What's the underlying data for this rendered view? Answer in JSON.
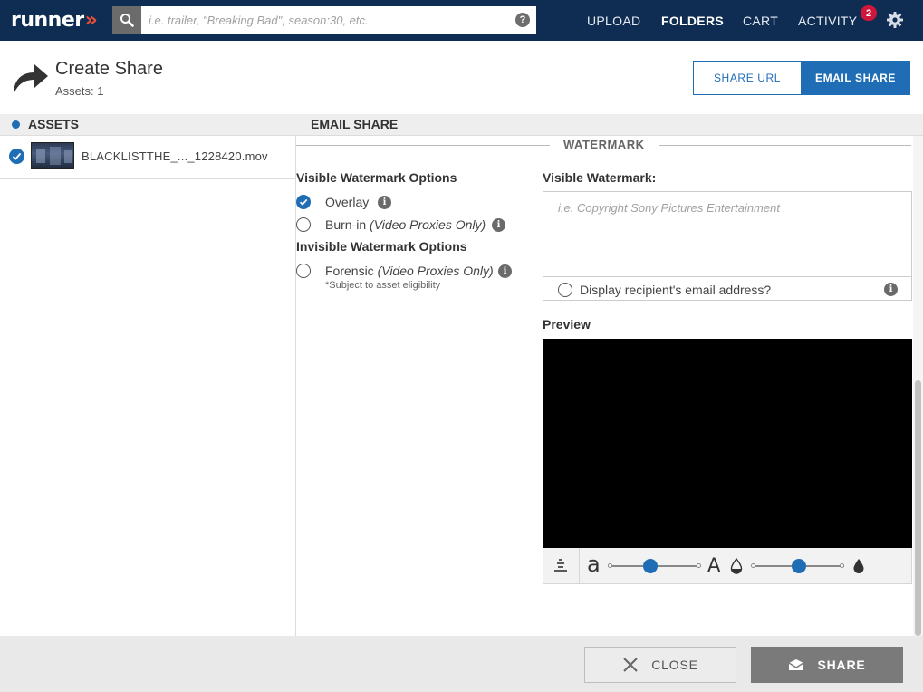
{
  "app": {
    "logo_text": "runner",
    "logo_chevrons": "»"
  },
  "search": {
    "placeholder": "i.e. trailer, \"Breaking Bad\", season:30, etc.",
    "value": ""
  },
  "nav": {
    "upload": "UPLOAD",
    "folders": "FOLDERS",
    "cart": "CART",
    "activity": "ACTIVITY",
    "activity_badge": "2",
    "active_item": "FOLDERS"
  },
  "header": {
    "title": "Create Share",
    "assets_count": "Assets: 1"
  },
  "share_mode": {
    "share_url_label": "SHARE URL",
    "email_share_label": "EMAIL SHARE",
    "selected": "EMAIL SHARE"
  },
  "sections": {
    "assets_heading": "ASSETS",
    "email_share_heading": "EMAIL SHARE"
  },
  "assets": [
    {
      "name": "BLACKLISTTHE_..._1228420.mov",
      "selected": true
    }
  ],
  "watermark": {
    "section_title": "WATERMARK",
    "visible_options_heading": "Visible Watermark Options",
    "overlay_label": "Overlay",
    "burnin_label": "Burn-in",
    "burnin_note": "(Video Proxies Only)",
    "invisible_options_heading": "Invisible Watermark Options",
    "forensic_label": "Forensic",
    "forensic_note": "(Video Proxies Only)",
    "eligibility_note": "*Subject to asset eligibility",
    "selected_visible_option": "Overlay",
    "visible_watermark_heading": "Visible Watermark:",
    "visible_watermark_placeholder": "i.e. Copyright Sony Pictures Entertainment",
    "visible_watermark_value": "",
    "display_recipient_label": "Display recipient's email address?",
    "display_recipient_checked": false,
    "preview_heading": "Preview",
    "controls": {
      "font_size_glyph_small": "a",
      "font_size_glyph_large": "A",
      "font_size_level": 0.45,
      "opacity_level": 0.5
    }
  },
  "footer": {
    "close_label": "CLOSE",
    "share_label": "SHARE"
  },
  "colors": {
    "nav_bg": "#0f2d52",
    "accent": "#1f6db5",
    "brand_chevron": "#e8503a",
    "badge": "#d0173b"
  }
}
